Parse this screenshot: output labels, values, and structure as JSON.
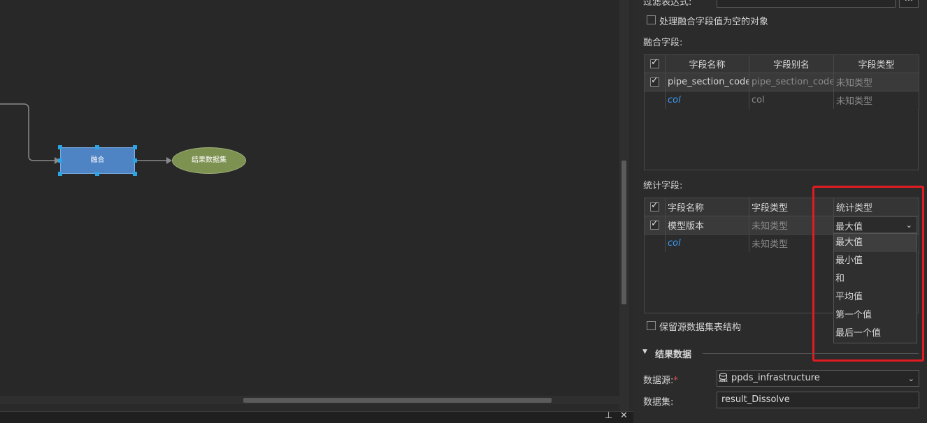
{
  "canvas": {
    "dissolve_node_label": "融合",
    "result_node_label": "结果数据集"
  },
  "bottom_panel": {
    "pin_icon": "⊥",
    "close_icon": "✕"
  },
  "panel": {
    "filter_label": "过滤表达式:",
    "filter_button": "...",
    "handle_null_label": "处理融合字段值为空的对象",
    "dissolve_fields_label": "融合字段:",
    "dissolve_table": {
      "headers": [
        "字段名称",
        "字段别名",
        "字段类型"
      ],
      "rows": [
        {
          "name": "pipe_section_code",
          "alias": "pipe_section_code",
          "type": "未知类型",
          "checked": true
        },
        {
          "name": "col",
          "alias": "col",
          "type": "未知类型",
          "checked": false
        }
      ]
    },
    "stat_fields_label": "统计字段:",
    "stat_table": {
      "headers": [
        "字段名称",
        "字段类型",
        "统计类型"
      ],
      "rows": [
        {
          "name": "模型版本",
          "type": "未知类型",
          "stat": "最大值",
          "checked": true
        },
        {
          "name": "col",
          "type": "未知类型",
          "stat": "",
          "checked": false
        }
      ]
    },
    "stat_dropdown": {
      "selected": "最大值",
      "options": [
        "最大值",
        "最小值",
        "和",
        "平均值",
        "第一个值",
        "最后一个值"
      ]
    },
    "keep_structure_label": "保留源数据集表结构",
    "result_section_title": "结果数据",
    "datasource_label": "数据源:",
    "required_mark": "*",
    "datasource_value": "ppds_infrastructure",
    "dataset_label": "数据集:",
    "dataset_value": "result_Dissolve",
    "udbx_icon_text": "UDBX"
  },
  "colors": {
    "highlight": "#e11b22",
    "node_blue": "#4f84c4",
    "node_green": "#7d9150",
    "link_blue": "#3d9cf5"
  }
}
